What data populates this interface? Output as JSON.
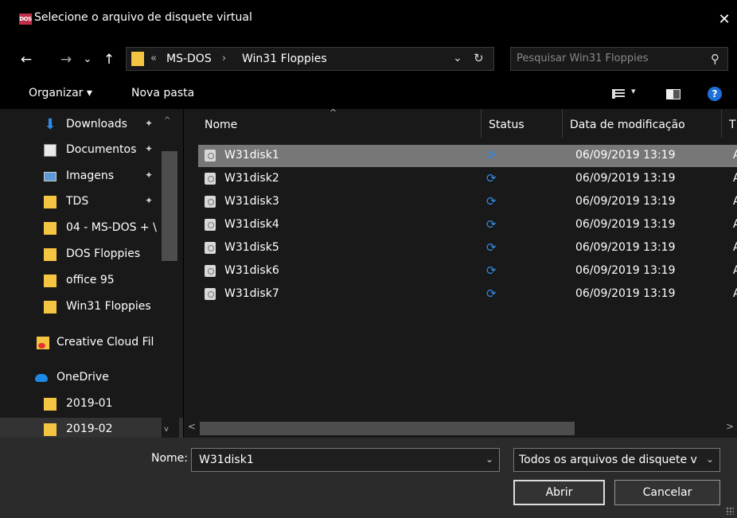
{
  "window": {
    "icon_text": "DOS",
    "title": "Selecione o arquivo de disquete virtual",
    "close_glyph": "✕"
  },
  "navbar": {
    "back_glyph": "←",
    "forward_glyph": "→",
    "recent_glyph": "⌄",
    "up_glyph": "↑",
    "breadcrumb_overflow": "«",
    "breadcrumb": [
      "MS-DOS",
      "Win31 Floppies"
    ],
    "breadcrumb_sep": "›",
    "dropdown_glyph": "⌄",
    "refresh_glyph": "↻",
    "search_placeholder": "Pesquisar Win31 Floppies",
    "search_glyph": "⚲"
  },
  "toolbar": {
    "organize": "Organizar ▾",
    "new_folder": "Nova pasta",
    "view_dd_glyph": "▾",
    "help_glyph": "?"
  },
  "nav_pane": {
    "items": [
      {
        "label": "Downloads",
        "icon": "download-icon",
        "pinned": true
      },
      {
        "label": "Documentos",
        "icon": "document-icon",
        "pinned": true
      },
      {
        "label": "Imagens",
        "icon": "images-icon",
        "pinned": true
      },
      {
        "label": "TDS",
        "icon": "folder-icon",
        "pinned": true
      },
      {
        "label": "04 - MS-DOS + \\",
        "icon": "folder-icon",
        "pinned": false
      },
      {
        "label": "DOS Floppies",
        "icon": "folder-icon",
        "pinned": false
      },
      {
        "label": "office 95",
        "icon": "folder-icon",
        "pinned": false
      },
      {
        "label": "Win31 Floppies",
        "icon": "folder-icon",
        "pinned": false
      },
      {
        "label": "Creative Cloud Fil",
        "icon": "creative-cloud-icon",
        "pinned": false
      },
      {
        "label": "OneDrive",
        "icon": "onedrive-icon",
        "pinned": false
      },
      {
        "label": "2019-01",
        "icon": "folder-icon",
        "pinned": false
      },
      {
        "label": "2019-02",
        "icon": "folder-icon",
        "pinned": false
      }
    ],
    "pin_glyph": "📌",
    "scroll_up_glyph": "^",
    "scroll_down_glyph": "v"
  },
  "file_list": {
    "columns": [
      "Nome",
      "Status",
      "Data de modificação",
      "T"
    ],
    "sort_glyph": "^",
    "sync_glyph": "⟳",
    "rows": [
      {
        "name": "W31disk1",
        "date": "06/09/2019 13:19",
        "type": "A",
        "selected": true
      },
      {
        "name": "W31disk2",
        "date": "06/09/2019 13:19",
        "type": "A",
        "selected": false
      },
      {
        "name": "W31disk3",
        "date": "06/09/2019 13:19",
        "type": "A",
        "selected": false
      },
      {
        "name": "W31disk4",
        "date": "06/09/2019 13:19",
        "type": "A",
        "selected": false
      },
      {
        "name": "W31disk5",
        "date": "06/09/2019 13:19",
        "type": "A",
        "selected": false
      },
      {
        "name": "W31disk6",
        "date": "06/09/2019 13:19",
        "type": "A",
        "selected": false
      },
      {
        "name": "W31disk7",
        "date": "06/09/2019 13:19",
        "type": "A",
        "selected": false
      }
    ],
    "hscroll_left_glyph": "<",
    "hscroll_right_glyph": ">"
  },
  "footer": {
    "name_label": "Nome:",
    "name_value": "W31disk1",
    "dropdown_glyph": "⌄",
    "filter_value": "Todos os arquivos de disquete v",
    "open_button": "Abrir",
    "cancel_button": "Cancelar"
  }
}
